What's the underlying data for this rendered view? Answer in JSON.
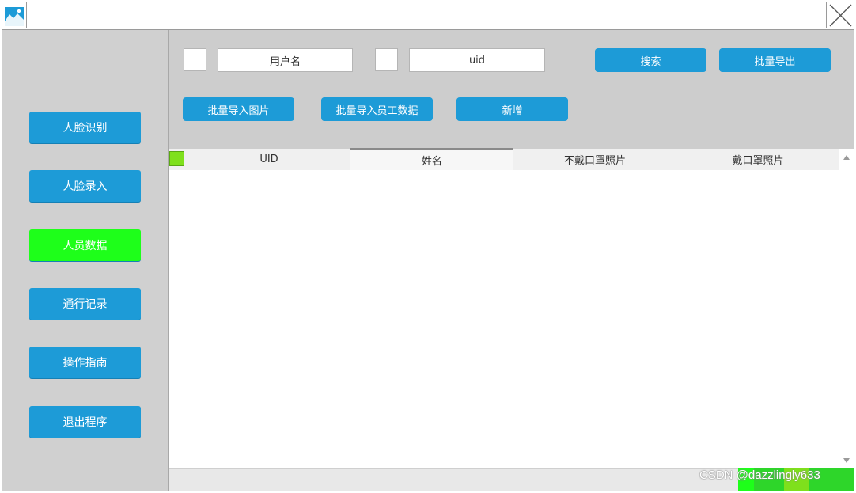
{
  "window": {
    "title": ""
  },
  "sidebar": {
    "items": [
      {
        "label": "人脸识别",
        "active": false
      },
      {
        "label": "人脸录入",
        "active": false
      },
      {
        "label": "人员数据",
        "active": true
      },
      {
        "label": "通行记录",
        "active": false
      },
      {
        "label": "操作指南",
        "active": false
      },
      {
        "label": "退出程序",
        "active": false
      }
    ]
  },
  "toolbar": {
    "username_field": "用户名",
    "uid_field": "uid",
    "search_label": "搜索",
    "batch_export_label": "批量导出",
    "batch_import_photos_label": "批量导入图片",
    "batch_import_staff_label": "批量导入员工数据",
    "add_label": "新增"
  },
  "table": {
    "columns": [
      "UID",
      "姓名",
      "不戴口罩照片",
      "戴口罩照片"
    ],
    "rows": []
  },
  "watermark": "CSDN @dazzlingly633",
  "colors": {
    "nav_button": "#1d9bd7",
    "nav_active": "#1eff1a",
    "select_all_checkbox": "#7fe01c",
    "pager": "#2ed62a"
  }
}
